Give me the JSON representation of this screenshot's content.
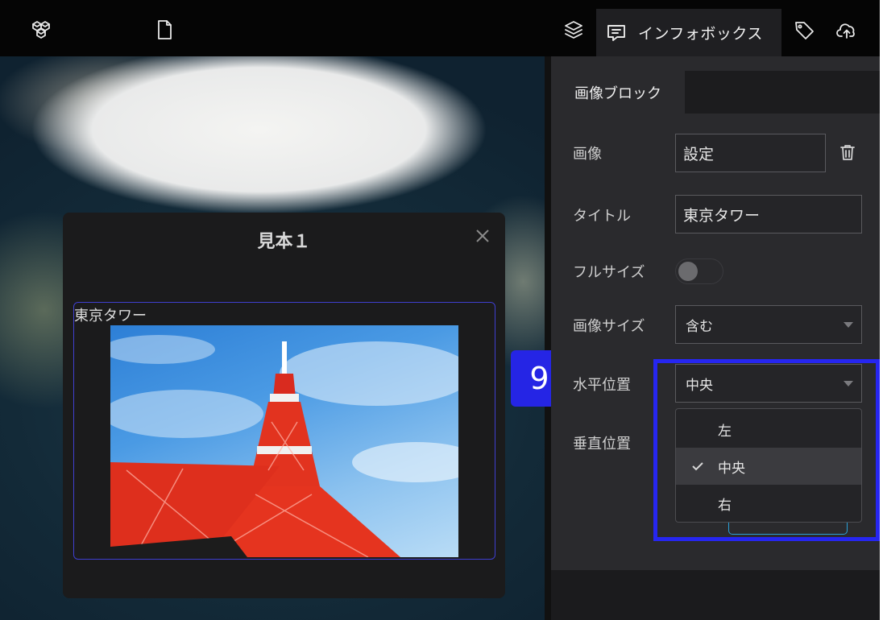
{
  "toolbar": {
    "active_tab_label": "インフォボックス",
    "icons": [
      "cubes-icon",
      "file-icon",
      "layers-icon",
      "infobox-icon",
      "tag-icon",
      "cloud-upload-icon"
    ]
  },
  "dialog": {
    "title": "見本１",
    "block_title": "東京タワー"
  },
  "marker": {
    "number": "9"
  },
  "panel": {
    "subtab": "画像ブロック",
    "fields": {
      "image_label": "画像",
      "image_value": "設定",
      "title_label": "タイトル",
      "title_value": "東京タワー",
      "fullsize_label": "フルサイズ",
      "image_size_label": "画像サイズ",
      "image_size_value": "含む",
      "h_position_label": "水平位置",
      "h_position_value": "中央",
      "v_position_label": "垂直位置"
    },
    "dropdown_options": [
      "左",
      "中央",
      "右"
    ],
    "selected_option": "中央"
  },
  "colors": {
    "accent_blue": "#2525e5",
    "panel_bg": "#2a2a2d",
    "toolbar_bg": "#050505"
  }
}
